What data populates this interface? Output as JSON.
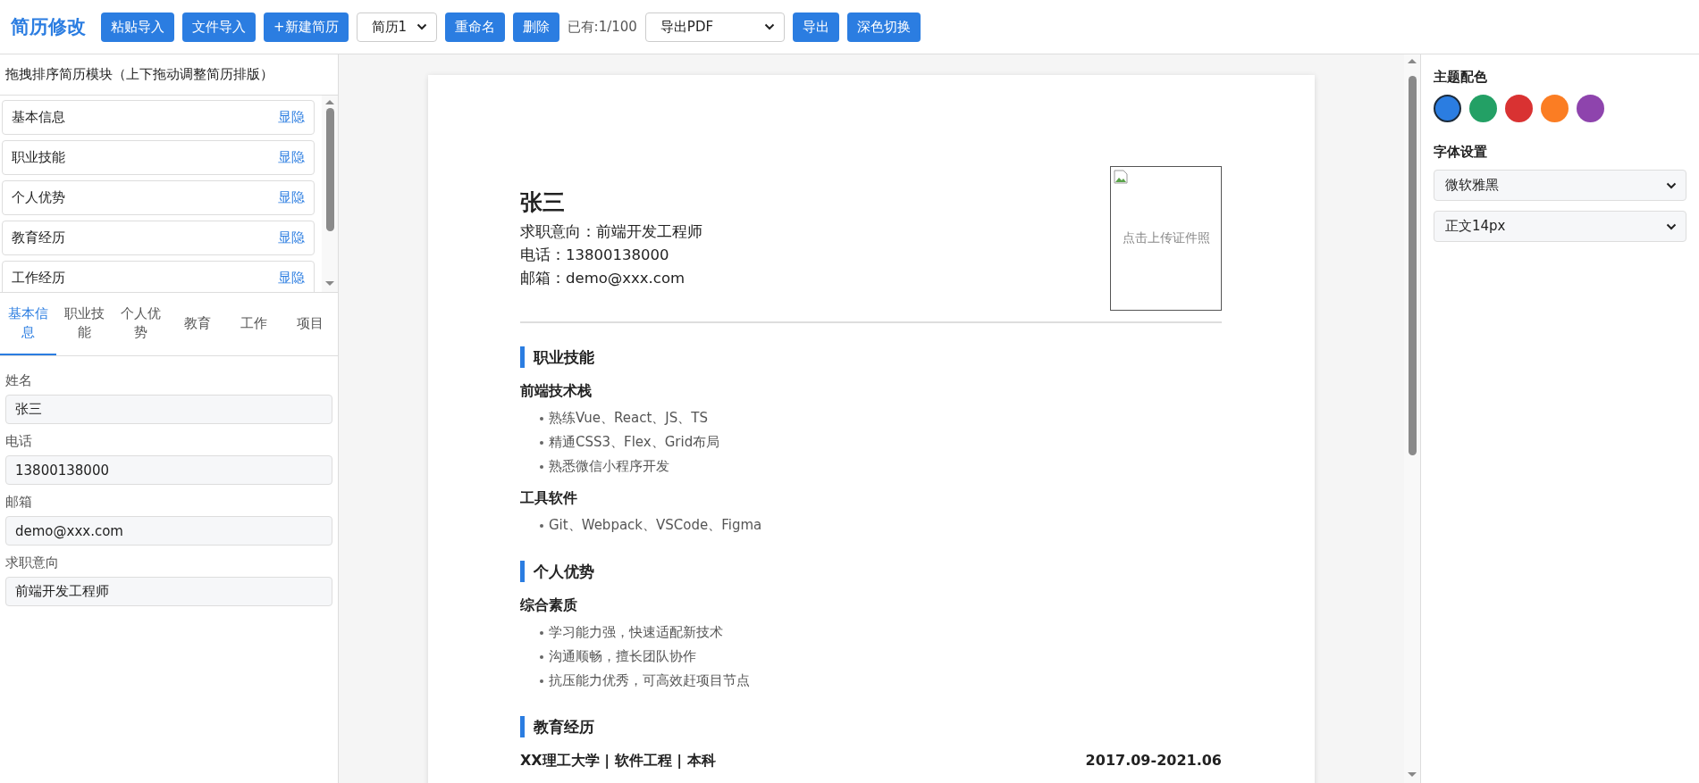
{
  "header": {
    "title": "简历修改",
    "controls": [
      {
        "kind": "button",
        "label": "粘贴导入"
      },
      {
        "kind": "button",
        "label": "文件导入"
      },
      {
        "kind": "button",
        "label": "+新建简历"
      },
      {
        "kind": "select",
        "label": "简历1"
      },
      {
        "kind": "button",
        "label": "重命名"
      },
      {
        "kind": "button",
        "label": "删除"
      },
      {
        "kind": "text",
        "label": "已有:1/100"
      },
      {
        "kind": "select",
        "label": "导出PDF"
      },
      {
        "kind": "button",
        "label": "导出"
      },
      {
        "kind": "button",
        "label": "深色切换"
      }
    ]
  },
  "sidebar": {
    "heading": "拖拽排序简历模块（上下拖动调整简历排版）",
    "modules": [
      {
        "name": "基本信息",
        "toggle": "显隐"
      },
      {
        "name": "职业技能",
        "toggle": "显隐"
      },
      {
        "name": "个人优势",
        "toggle": "显隐"
      },
      {
        "name": "教育经历",
        "toggle": "显隐"
      },
      {
        "name": "工作经历",
        "toggle": "显隐"
      }
    ],
    "tabs": [
      {
        "label": "基本信息",
        "selected": true
      },
      {
        "label": "职业技能",
        "selected": false
      },
      {
        "label": "个人优势",
        "selected": false
      },
      {
        "label": "教育",
        "selected": false
      },
      {
        "label": "工作",
        "selected": false
      },
      {
        "label": "项目",
        "selected": false
      }
    ],
    "fields": [
      {
        "label": "姓名",
        "value": "张三"
      },
      {
        "label": "电话",
        "value": "13800138000"
      },
      {
        "label": "邮箱",
        "value": "demo@xxx.com"
      },
      {
        "label": "求职意向",
        "value": "前端开发工程师"
      }
    ]
  },
  "resume": {
    "name": "张三",
    "contact": [
      "求职意向：前端开发工程师",
      "电话：13800138000",
      "邮箱：demo@xxx.com"
    ],
    "photo_hint": "点击上传证件照",
    "sections": [
      {
        "title": "职业技能",
        "groups": [
          {
            "subtitle": "前端技术栈",
            "items": [
              "熟练Vue、React、JS、TS",
              "精通CSS3、Flex、Grid布局",
              "熟悉微信小程序开发"
            ]
          },
          {
            "subtitle": "工具软件",
            "items": [
              "Git、Webpack、VSCode、Figma"
            ]
          }
        ]
      },
      {
        "title": "个人优势",
        "groups": [
          {
            "subtitle": "综合素质",
            "items": [
              "学习能力强，快速适配新技术",
              "沟通顺畅，擅长团队协作",
              "抗压能力优秀，可高效赶项目节点"
            ]
          }
        ]
      },
      {
        "title": "教育经历",
        "entries": [
          {
            "school": "XX理工大学 | 软件工程 | 本科",
            "period": "2017.09-2021.06"
          }
        ]
      }
    ]
  },
  "settings": {
    "theme_heading": "主题配色",
    "colors": [
      {
        "color": "#2b7de1",
        "selected": true
      },
      {
        "color": "#23a065",
        "selected": false
      },
      {
        "color": "#d93232",
        "selected": false
      },
      {
        "color": "#fb7d23",
        "selected": false
      },
      {
        "color": "#8e44ad",
        "selected": false
      }
    ],
    "font_heading": "字体设置",
    "selects": [
      {
        "value": "微软雅黑"
      },
      {
        "value": "正文14px"
      }
    ]
  }
}
